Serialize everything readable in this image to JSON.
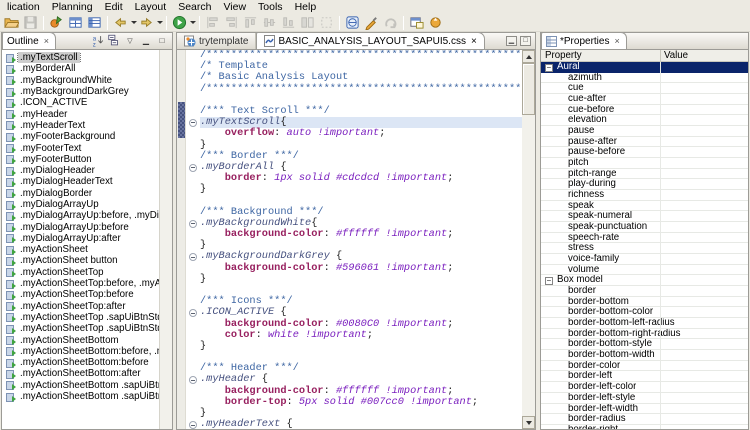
{
  "menu": {
    "items": [
      "lication",
      "Planning",
      "Edit",
      "Layout",
      "Search",
      "View",
      "Tools",
      "Help"
    ]
  },
  "toolbar": {
    "buttons": [
      {
        "icon": "open-folder-icon",
        "disabled": false
      },
      {
        "icon": "save-icon",
        "disabled": true
      },
      "sep",
      {
        "icon": "new-wizard-icon",
        "disabled": false
      },
      {
        "icon": "table-view-icon",
        "disabled": false
      },
      {
        "icon": "table-view-alt-icon",
        "disabled": false
      },
      "sep",
      {
        "icon": "back-arrow-icon",
        "disabled": false,
        "caret": true
      },
      {
        "icon": "forward-arrow-icon",
        "disabled": false,
        "caret": true
      },
      "sep",
      {
        "icon": "run-icon",
        "disabled": false,
        "caret": true
      },
      "sep",
      {
        "icon": "align-left-icon",
        "disabled": true
      },
      {
        "icon": "align-right-icon",
        "disabled": true
      },
      {
        "icon": "align-top-icon",
        "disabled": true
      },
      {
        "icon": "align-middle-icon",
        "disabled": true
      },
      {
        "icon": "align-bottom-icon",
        "disabled": true
      },
      {
        "icon": "match-size-icon",
        "disabled": true
      },
      {
        "icon": "marquee-icon",
        "disabled": true
      },
      "sep",
      {
        "icon": "web-page-icon",
        "disabled": false
      },
      {
        "icon": "link-edit-icon",
        "disabled": false
      },
      {
        "icon": "redo-icon",
        "disabled": true
      },
      "sep",
      {
        "icon": "new-window-icon",
        "disabled": false
      },
      {
        "icon": "sync-icon",
        "disabled": false
      }
    ]
  },
  "outline": {
    "tab_label": "Outline",
    "toolbar_icons": [
      "sort-icon",
      "collapse-all-icon",
      "view-menu-icon",
      "minimize-icon",
      "maximize-icon"
    ],
    "items": [
      {
        "label": ".myTextScroll",
        "selected": true
      },
      {
        "label": ".myBorderAll",
        "selected": false
      },
      {
        "label": ".myBackgroundWhite",
        "selected": false
      },
      {
        "label": ".myBackgroundDarkGrey",
        "selected": false
      },
      {
        "label": ".ICON_ACTIVE",
        "selected": false
      },
      {
        "label": ".myHeader",
        "selected": false
      },
      {
        "label": ".myHeaderText",
        "selected": false
      },
      {
        "label": ".myFooterBackground",
        "selected": false
      },
      {
        "label": ".myFooterText",
        "selected": false
      },
      {
        "label": ".myFooterButton",
        "selected": false
      },
      {
        "label": ".myDialogHeader",
        "selected": false
      },
      {
        "label": ".myDialogHeaderText",
        "selected": false
      },
      {
        "label": ".myDialogBorder",
        "selected": false
      },
      {
        "label": ".myDialogArrayUp",
        "selected": false
      },
      {
        "label": ".myDialogArrayUp:before, .myDialogArrayUp:after",
        "selected": false
      },
      {
        "label": ".myDialogArrayUp:before",
        "selected": false
      },
      {
        "label": ".myDialogArrayUp:after",
        "selected": false
      },
      {
        "label": ".myActionSheet",
        "selected": false
      },
      {
        "label": ".myActionSheet button",
        "selected": false
      },
      {
        "label": ".myActionSheetTop",
        "selected": false
      },
      {
        "label": ".myActionSheetTop:before, .myActionSheetTop:after",
        "selected": false
      },
      {
        "label": ".myActionSheetTop:before",
        "selected": false
      },
      {
        "label": ".myActionSheetTop:after",
        "selected": false
      },
      {
        "label": ".myActionSheetTop .sapUiBtnStd.sapUiBtnNorm",
        "selected": false
      },
      {
        "label": ".myActionSheetTop .sapUiBtnStd.sapUiBtnNorm",
        "selected": false
      },
      {
        "label": ".myActionSheetBottom",
        "selected": false
      },
      {
        "label": ".myActionSheetBottom:before, .myActionSheetBottom:after",
        "selected": false
      },
      {
        "label": ".myActionSheetBottom:before",
        "selected": false
      },
      {
        "label": ".myActionSheetBottom:after",
        "selected": false
      },
      {
        "label": ".myActionSheetBottom .sapUiBtnStd.sapUiBtnNorm",
        "selected": false
      },
      {
        "label": ".myActionSheetBottom .sapUiBtnStd.sapUiBtnNorm",
        "selected": false
      }
    ]
  },
  "editor": {
    "tabs": [
      {
        "label": "trytemplate",
        "active": false,
        "icon": "template-file-icon"
      },
      {
        "label": "BASIC_ANALYSIS_LAYOUT_SAPUI5.css",
        "active": true,
        "icon": "css-file-icon"
      }
    ],
    "lines": [
      {
        "segs": [
          [
            "c",
            "/**********************************************************************************"
          ]
        ]
      },
      {
        "segs": [
          [
            "c",
            "/* Template"
          ]
        ]
      },
      {
        "segs": [
          [
            "c",
            "/* Basic Analysis Layout"
          ]
        ]
      },
      {
        "segs": [
          [
            "c",
            "/**********************************************************************************"
          ]
        ]
      },
      {
        "segs": []
      },
      {
        "segs": [
          [
            "c",
            "/*** Text Scroll ***/"
          ]
        ]
      },
      {
        "fold": true,
        "hl": true,
        "segs": [
          [
            "s",
            ".myTextScroll"
          ],
          [
            "n",
            "{"
          ]
        ]
      },
      {
        "segs": [
          [
            "n",
            "    "
          ],
          [
            "p",
            "overflow"
          ],
          [
            "n",
            ": "
          ],
          [
            "v",
            "auto !important"
          ],
          [
            "n",
            ";"
          ]
        ]
      },
      {
        "segs": [
          [
            "n",
            "}"
          ]
        ]
      },
      {
        "segs": [
          [
            "c",
            "/*** Border ***/"
          ]
        ]
      },
      {
        "fold": true,
        "segs": [
          [
            "s",
            ".myBorderAll"
          ],
          [
            "n",
            " {"
          ]
        ]
      },
      {
        "segs": [
          [
            "n",
            "    "
          ],
          [
            "p",
            "border"
          ],
          [
            "n",
            ": "
          ],
          [
            "v",
            "1px solid #cdcdcd !important"
          ],
          [
            "n",
            ";"
          ]
        ]
      },
      {
        "segs": [
          [
            "n",
            "}"
          ]
        ]
      },
      {
        "segs": []
      },
      {
        "segs": [
          [
            "c",
            "/*** Background ***/"
          ]
        ]
      },
      {
        "fold": true,
        "segs": [
          [
            "s",
            ".myBackgroundWhite"
          ],
          [
            "n",
            "{"
          ]
        ]
      },
      {
        "segs": [
          [
            "n",
            "    "
          ],
          [
            "p",
            "background-color"
          ],
          [
            "n",
            ": "
          ],
          [
            "v",
            "#ffffff !important"
          ],
          [
            "n",
            ";"
          ]
        ]
      },
      {
        "segs": [
          [
            "n",
            "}"
          ]
        ]
      },
      {
        "fold": true,
        "segs": [
          [
            "s",
            ".myBackgroundDarkGrey"
          ],
          [
            "n",
            " {"
          ]
        ]
      },
      {
        "segs": [
          [
            "n",
            "    "
          ],
          [
            "p",
            "background-color"
          ],
          [
            "n",
            ": "
          ],
          [
            "v",
            "#596061 !important"
          ],
          [
            "n",
            ";"
          ]
        ]
      },
      {
        "segs": [
          [
            "n",
            "}"
          ]
        ]
      },
      {
        "segs": []
      },
      {
        "segs": [
          [
            "c",
            "/*** Icons ***/"
          ]
        ]
      },
      {
        "fold": true,
        "segs": [
          [
            "s",
            ".ICON_ACTIVE"
          ],
          [
            "n",
            " {"
          ]
        ]
      },
      {
        "segs": [
          [
            "n",
            "    "
          ],
          [
            "p",
            "background-color"
          ],
          [
            "n",
            ": "
          ],
          [
            "v",
            "#0080C0 !important"
          ],
          [
            "n",
            ";"
          ]
        ]
      },
      {
        "segs": [
          [
            "n",
            "    "
          ],
          [
            "p",
            "color"
          ],
          [
            "n",
            ": "
          ],
          [
            "v",
            "white !important"
          ],
          [
            "n",
            ";"
          ]
        ]
      },
      {
        "segs": [
          [
            "n",
            "}"
          ]
        ]
      },
      {
        "segs": []
      },
      {
        "segs": [
          [
            "c",
            "/*** Header ***/"
          ]
        ]
      },
      {
        "fold": true,
        "segs": [
          [
            "s",
            ".myHeader"
          ],
          [
            "n",
            " {"
          ]
        ]
      },
      {
        "segs": [
          [
            "n",
            "    "
          ],
          [
            "p",
            "background-color"
          ],
          [
            "n",
            ": "
          ],
          [
            "v",
            "#ffffff !important"
          ],
          [
            "n",
            ";"
          ]
        ]
      },
      {
        "segs": [
          [
            "n",
            "    "
          ],
          [
            "p",
            "border-top"
          ],
          [
            "n",
            ": "
          ],
          [
            "v",
            "5px solid #007cc0 !important"
          ],
          [
            "n",
            ";"
          ]
        ]
      },
      {
        "segs": [
          [
            "n",
            "}"
          ]
        ]
      },
      {
        "fold": true,
        "segs": [
          [
            "s",
            ".myHeaderText"
          ],
          [
            "n",
            " {"
          ]
        ]
      }
    ]
  },
  "properties": {
    "tab_label": "*Properties",
    "columns": [
      "Property",
      "Value"
    ],
    "rows": [
      {
        "label": "Aural",
        "type": "category",
        "selected": true,
        "value": ""
      },
      {
        "label": "azimuth",
        "type": "item",
        "value": ""
      },
      {
        "label": "cue",
        "type": "item",
        "value": ""
      },
      {
        "label": "cue-after",
        "type": "item",
        "value": ""
      },
      {
        "label": "cue-before",
        "type": "item",
        "value": ""
      },
      {
        "label": "elevation",
        "type": "item",
        "value": ""
      },
      {
        "label": "pause",
        "type": "item",
        "value": ""
      },
      {
        "label": "pause-after",
        "type": "item",
        "value": ""
      },
      {
        "label": "pause-before",
        "type": "item",
        "value": ""
      },
      {
        "label": "pitch",
        "type": "item",
        "value": ""
      },
      {
        "label": "pitch-range",
        "type": "item",
        "value": ""
      },
      {
        "label": "play-during",
        "type": "item",
        "value": ""
      },
      {
        "label": "richness",
        "type": "item",
        "value": ""
      },
      {
        "label": "speak",
        "type": "item",
        "value": ""
      },
      {
        "label": "speak-numeral",
        "type": "item",
        "value": ""
      },
      {
        "label": "speak-punctuation",
        "type": "item",
        "value": ""
      },
      {
        "label": "speech-rate",
        "type": "item",
        "value": ""
      },
      {
        "label": "stress",
        "type": "item",
        "value": ""
      },
      {
        "label": "voice-family",
        "type": "item",
        "value": ""
      },
      {
        "label": "volume",
        "type": "item",
        "value": ""
      },
      {
        "label": "Box model",
        "type": "category",
        "selected": false,
        "value": ""
      },
      {
        "label": "border",
        "type": "item",
        "value": ""
      },
      {
        "label": "border-bottom",
        "type": "item",
        "value": ""
      },
      {
        "label": "border-bottom-color",
        "type": "item",
        "value": ""
      },
      {
        "label": "border-bottom-left-radius",
        "type": "item",
        "value": ""
      },
      {
        "label": "border-bottom-right-radius",
        "type": "item",
        "value": ""
      },
      {
        "label": "border-bottom-style",
        "type": "item",
        "value": ""
      },
      {
        "label": "border-bottom-width",
        "type": "item",
        "value": ""
      },
      {
        "label": "border-color",
        "type": "item",
        "value": ""
      },
      {
        "label": "border-left",
        "type": "item",
        "value": ""
      },
      {
        "label": "border-left-color",
        "type": "item",
        "value": ""
      },
      {
        "label": "border-left-style",
        "type": "item",
        "value": ""
      },
      {
        "label": "border-left-width",
        "type": "item",
        "value": ""
      },
      {
        "label": "border-radius",
        "type": "item",
        "value": ""
      },
      {
        "label": "border-right",
        "type": "item",
        "value": ""
      }
    ]
  },
  "colors": {
    "selection_navy": "#0A246A",
    "current_line_highlight": "#DCE6F5",
    "comment_blue": "#3E66A3",
    "selector_slate": "#46517F",
    "property_maroon": "#97205F",
    "value_purple": "#7A1FBE",
    "window_chrome": "#ECEAE2"
  }
}
